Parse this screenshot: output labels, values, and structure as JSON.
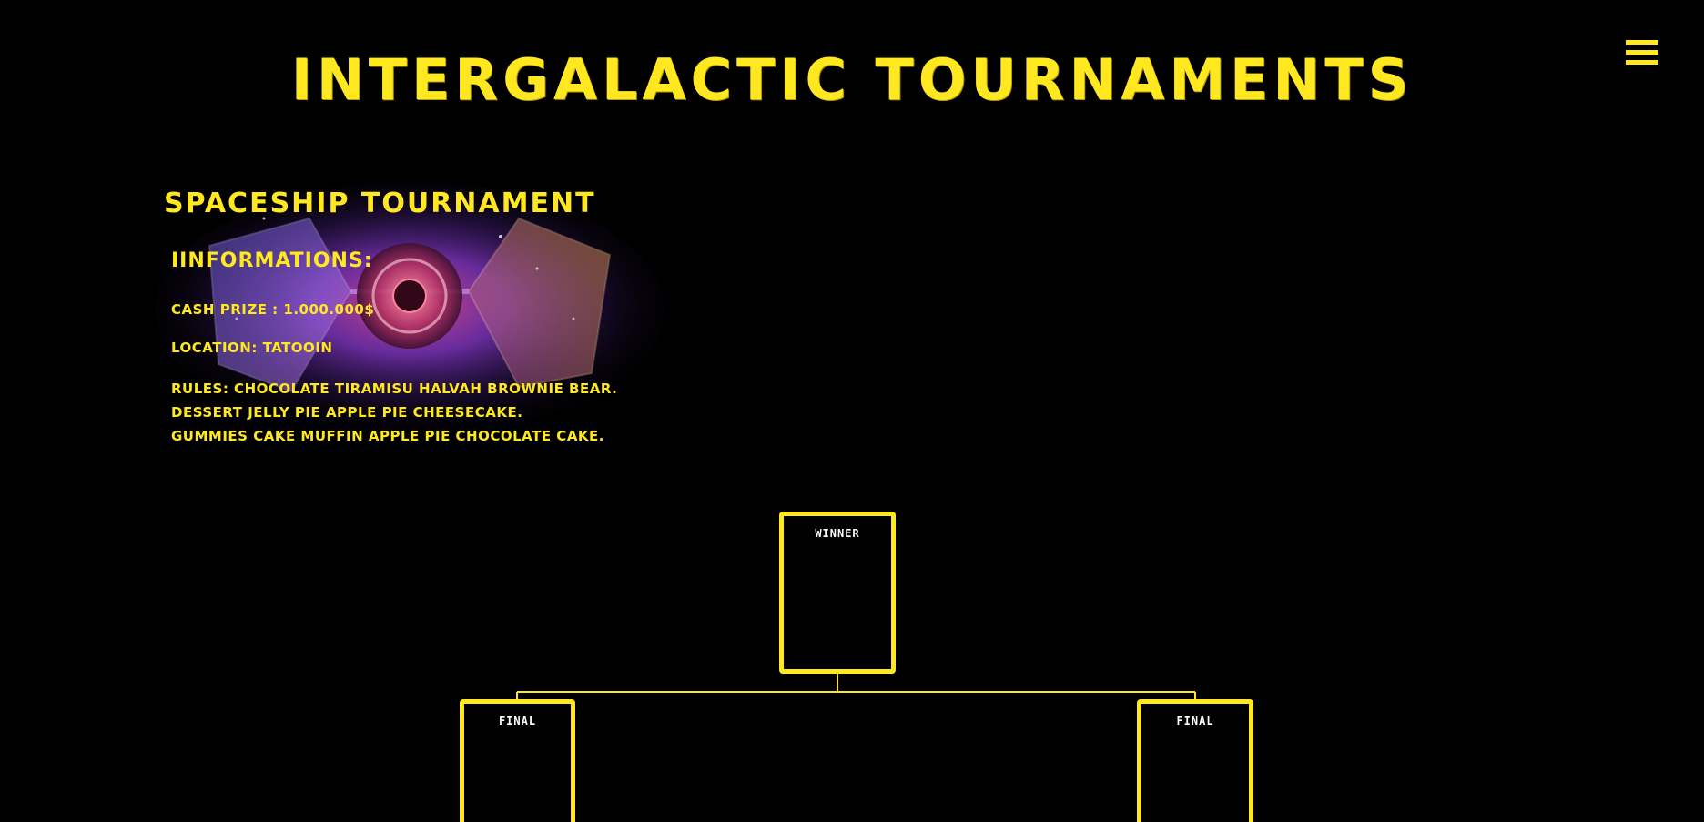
{
  "header": {
    "title": "INTERGALACTIC TOURNAMENTS",
    "menu_icon": "hamburger-menu-icon"
  },
  "tournament": {
    "name": "SPACESHIP TOURNAMENT",
    "info_heading": "IINFORMATIONS:",
    "cash_prize": "CASH PRIZE : 1.000.000$",
    "location": "LOCATION: TATOOIN",
    "rules": [
      "RULES: CHOCOLATE TIRAMISU HALVAH BROWNIE BEAR.",
      "DESSERT JELLY PIE APPLE PIE CHEESECAKE.",
      "GUMMIES CAKE MUFFIN APPLE PIE CHOCOLATE CAKE."
    ],
    "artwork": "spaceship-artwork"
  },
  "bracket": {
    "winner_label": "WINNER",
    "final_left_label": "FINAL",
    "final_right_label": "FINAL"
  },
  "colors": {
    "background": "#000000",
    "accent": "#FFE81F",
    "slot_label": "#FFFFFF"
  }
}
